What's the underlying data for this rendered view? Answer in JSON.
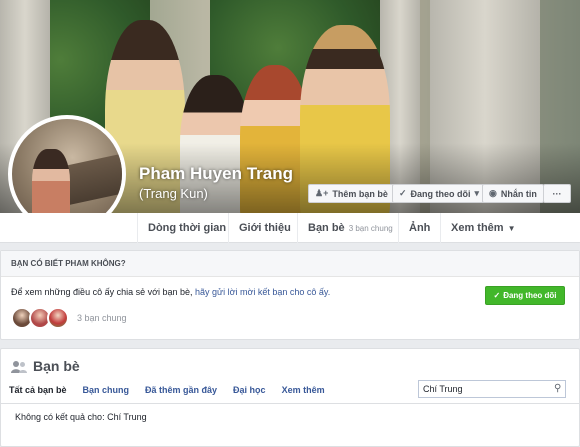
{
  "profile": {
    "name": "Pham Huyen Trang",
    "alternate_name": "(Trang Kun)"
  },
  "cover_actions": {
    "add_friend": "Thêm bạn bè",
    "following": "Đang theo dõi",
    "message": "Nhắn tin",
    "more": "···"
  },
  "nav": {
    "timeline": "Dòng thời gian",
    "about": "Giới thiệu",
    "friends": "Bạn bè",
    "friends_sub": "3 bạn chung",
    "photos": "Ảnh",
    "more": "Xem thêm"
  },
  "know_card": {
    "heading": "BẠN CÓ BIẾT PHAM KHÔNG?",
    "text_prefix": "Để xem những điều cô ấy chia sẻ với bạn bè, ",
    "text_link": "hãy gửi lời mời kết bạn cho cô ấy.",
    "follow_button": "Đang theo dõi",
    "mutual_label": "3 bạn chung"
  },
  "friends_card": {
    "title": "Bạn bè",
    "tabs": [
      "Tất cả bạn bè",
      "Bạn chung",
      "Đã thêm gần đây",
      "Đại học",
      "Xem thêm"
    ],
    "search_value": "Chí Trung",
    "no_results": "Không có kết quả cho: Chí Trung"
  },
  "colors": {
    "link": "#385898",
    "green": "#42b72a",
    "background": "#e9ebee"
  }
}
